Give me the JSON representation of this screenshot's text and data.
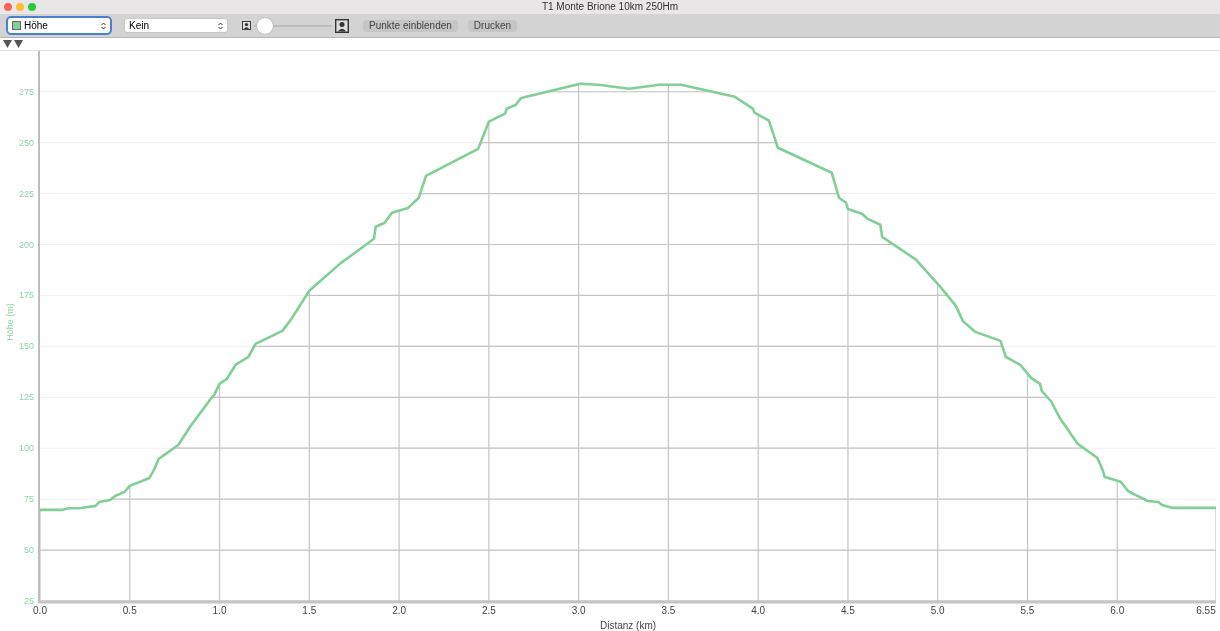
{
  "window": {
    "title": "T1 Monte Brione 10km 250Hm"
  },
  "toolbar": {
    "series_select": {
      "focused": true
    },
    "secondary_select": {
      "value": "Kein",
      "focused": false
    },
    "zoom_slider": {
      "level": 0.05
    },
    "buttons": [
      "Punkte einblenden",
      "Drucken"
    ]
  },
  "chart": {
    "chart_data": {
      "type": "line",
      "xlabel": "Distanz (km)",
      "ylabel": "Höhe (m)",
      "x": [
        0,
        0.12,
        0.16,
        0.22,
        0.31,
        0.33,
        0.39,
        0.42,
        0.47,
        0.5,
        0.61,
        0.64,
        0.66,
        0.7,
        0.77,
        0.84,
        0.91,
        0.95,
        0.97,
        1.0,
        1.04,
        1.09,
        1.16,
        1.2,
        1.35,
        1.4,
        1.5,
        1.67,
        1.86,
        1.87,
        1.92,
        1.96,
        2.05,
        2.11,
        2.15,
        2.44,
        2.5,
        2.59,
        2.6,
        2.65,
        2.68,
        3.01,
        3.11,
        3.28,
        3.45,
        3.57,
        3.87,
        3.93,
        3.97,
        3.98,
        4.06,
        4.11,
        4.41,
        4.45,
        4.49,
        4.5,
        4.58,
        4.61,
        4.68,
        4.69,
        4.88,
        5.01,
        5.1,
        5.14,
        5.21,
        5.35,
        5.38,
        5.46,
        5.52,
        5.57,
        5.58,
        5.63,
        5.68,
        5.78,
        5.89,
        5.92,
        5.93,
        6.02,
        6.06,
        6.09,
        6.17,
        6.23,
        6.25,
        6.31,
        6.52,
        6.55
      ],
      "series": [
        {
          "name": "Höhe",
          "color": "#7fcf97",
          "values": [
            69.7,
            69.7,
            70.5,
            70.5,
            71.7,
            73.6,
            74.6,
            76.6,
            78.5,
            81.5,
            85.4,
            90.3,
            94.7,
            97.2,
            101.6,
            111,
            119.3,
            124.2,
            126.2,
            131.6,
            134,
            141,
            144.8,
            151.2,
            157.6,
            163.5,
            177.3,
            190.5,
            202.8,
            208.7,
            210.7,
            215.6,
            218,
            223,
            233.7,
            247,
            260.3,
            264.2,
            266.7,
            268.6,
            272,
            278.9,
            278.4,
            276.5,
            278.4,
            278.4,
            272.5,
            269.1,
            266.7,
            264.7,
            260.8,
            247.5,
            235.2,
            223,
            220.5,
            217.5,
            215,
            212.6,
            209.7,
            203.8,
            192.5,
            179.7,
            170,
            162.5,
            157.1,
            152.7,
            144.8,
            140.9,
            134.5,
            131.6,
            128.1,
            123.2,
            114.9,
            102.1,
            95.2,
            88.9,
            85.9,
            83.5,
            79,
            77.6,
            74.1,
            73.6,
            72.2,
            70.7,
            70.7,
            70.7
          ]
        }
      ],
      "grid": true,
      "xlim": [
        0,
        6.55
      ],
      "ylim": [
        25,
        295
      ],
      "xticks": [
        {
          "value": 0,
          "label": "0.0"
        },
        {
          "value": 0.5,
          "label": "0.5"
        },
        {
          "value": 1,
          "label": "1.0"
        },
        {
          "value": 1.5,
          "label": "1.5"
        },
        {
          "value": 2,
          "label": "2.0"
        },
        {
          "value": 2.5,
          "label": "2.5"
        },
        {
          "value": 3,
          "label": "3.0"
        },
        {
          "value": 3.5,
          "label": "3.5"
        },
        {
          "value": 4,
          "label": "4.0"
        },
        {
          "value": 4.5,
          "label": "4.5"
        },
        {
          "value": 5,
          "label": "5.0"
        },
        {
          "value": 5.5,
          "label": "5.5"
        },
        {
          "value": 6,
          "label": "6.0"
        },
        {
          "value": 6.55,
          "label": "6.55"
        }
      ],
      "yticks": [
        25,
        50,
        75,
        100,
        125,
        150,
        175,
        200,
        225,
        250,
        275
      ]
    }
  }
}
